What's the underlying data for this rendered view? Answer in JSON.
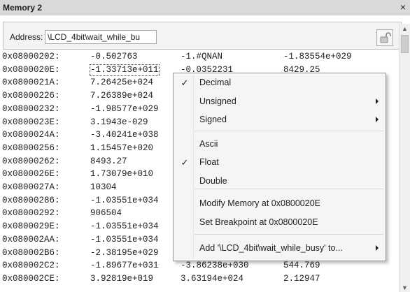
{
  "window": {
    "title": "Memory 2",
    "close_glyph": "×"
  },
  "address_bar": {
    "label": "Address:",
    "value": "\\LCD_4bit\\wait_while_bu"
  },
  "scrollbar": {
    "up_glyph": "▲",
    "down_glyph": "▼"
  },
  "rows": [
    {
      "addr": "0x08000202:",
      "v1": "-0.502763",
      "v2": "-1.#QNAN",
      "v3": "-1.83554e+029"
    },
    {
      "addr": "0x0800020E:",
      "v1": "-1.33713e+011",
      "v2": "-0.0352231",
      "v3": "8429.25"
    },
    {
      "addr": "0x0800021A:",
      "v1": "7.26425e+024",
      "v2": "",
      "v3": ""
    },
    {
      "addr": "0x08000226:",
      "v1": "7.26389e+024",
      "v2": "",
      "v3": ""
    },
    {
      "addr": "0x08000232:",
      "v1": "-1.98577e+029",
      "v2": "",
      "v3": ""
    },
    {
      "addr": "0x0800023E:",
      "v1": "3.1943e-029",
      "v2": "",
      "v3": ""
    },
    {
      "addr": "0x0800024A:",
      "v1": "-3.40241e+038",
      "v2": "",
      "v3": ""
    },
    {
      "addr": "0x08000256:",
      "v1": "1.15457e+020",
      "v2": "",
      "v3": ""
    },
    {
      "addr": "0x08000262:",
      "v1": "8493.27",
      "v2": "",
      "v3": ""
    },
    {
      "addr": "0x0800026E:",
      "v1": "1.73079e+010",
      "v2": "",
      "v3": ""
    },
    {
      "addr": "0x0800027A:",
      "v1": "10304",
      "v2": "",
      "v3": ""
    },
    {
      "addr": "0x08000286:",
      "v1": "-1.03551e+034",
      "v2": "",
      "v3": ""
    },
    {
      "addr": "0x08000292:",
      "v1": "906504",
      "v2": "",
      "v3": ""
    },
    {
      "addr": "0x0800029E:",
      "v1": "-1.03551e+034",
      "v2": "",
      "v3": ""
    },
    {
      "addr": "0x080002AA:",
      "v1": "-1.03551e+034",
      "v2": "",
      "v3": ""
    },
    {
      "addr": "0x080002B6:",
      "v1": "-2.38195e+029",
      "v2": "",
      "v3": ""
    },
    {
      "addr": "0x080002C2:",
      "v1": "-1.89677e+031",
      "v2": "-3.86238e+030",
      "v3": "544.769"
    },
    {
      "addr": "0x080002CE:",
      "v1": "3.92819e+019",
      "v2": "3.63194e+024",
      "v3": "2.12947"
    }
  ],
  "context_menu": {
    "items": [
      {
        "label": "Decimal",
        "checked": true,
        "submenu": false,
        "name": "menu-item-decimal"
      },
      {
        "label": "Unsigned",
        "checked": false,
        "submenu": true,
        "name": "menu-item-unsigned"
      },
      {
        "label": "Signed",
        "checked": false,
        "submenu": true,
        "name": "menu-item-signed"
      },
      {
        "label": "Ascii",
        "checked": false,
        "submenu": false,
        "name": "menu-item-ascii"
      },
      {
        "label": "Float",
        "checked": true,
        "submenu": false,
        "name": "menu-item-float"
      },
      {
        "label": "Double",
        "checked": false,
        "submenu": false,
        "name": "menu-item-double"
      },
      {
        "label": "Modify Memory at 0x0800020E",
        "checked": false,
        "submenu": false,
        "name": "menu-item-modify-memory"
      },
      {
        "label": "Set Breakpoint at 0x0800020E",
        "checked": false,
        "submenu": false,
        "name": "menu-item-set-breakpoint"
      },
      {
        "label": "Add '\\LCD_4bit\\wait_while_busy' to...",
        "checked": false,
        "submenu": true,
        "name": "menu-item-add-to"
      }
    ],
    "check_glyph": "✓"
  }
}
